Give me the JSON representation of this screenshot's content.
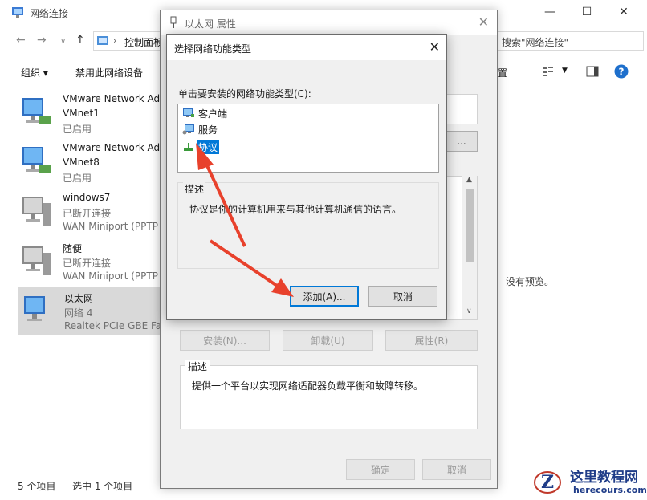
{
  "main_window": {
    "title": "网络连接",
    "breadcrumb": "控制面板",
    "search_placeholder": "搜索\"网络连接\"",
    "toolbar": {
      "organize": "组织",
      "disable_device": "禁用此网络设备",
      "partial_right": "置"
    },
    "connections": [
      {
        "name": "VMware Network Ad",
        "line2": "VMnet1",
        "line3": "已启用"
      },
      {
        "name": "VMware Network Ad",
        "line2": "VMnet8",
        "line3": "已启用"
      },
      {
        "name": "windows7",
        "line2": "已断开连接",
        "line3": "WAN Miniport (PPTP"
      },
      {
        "name": "随便",
        "line2": "已断开连接",
        "line3": "WAN Miniport (PPTP"
      },
      {
        "name": "以太网",
        "line2": "网络 4",
        "line3": "Realtek PCIe GBE Far"
      }
    ],
    "status": {
      "count": "5 个项目",
      "selected": "选中 1 个项目"
    },
    "preview_text": "没有预览。"
  },
  "properties_dialog": {
    "title": "以太网 属性",
    "buttons": {
      "install": "安装(N)...",
      "uninstall": "卸载(U)",
      "properties": "属性(R)",
      "ok": "确定",
      "cancel": "取消",
      "configure": "..."
    },
    "description_label": "描述",
    "description_text": "提供一个平台以实现网络适配器负载平衡和故障转移。"
  },
  "select_dialog": {
    "title": "选择网络功能类型",
    "prompt": "单击要安装的网络功能类型(C):",
    "options": [
      {
        "label": "客户端"
      },
      {
        "label": "服务"
      },
      {
        "label": "协议"
      }
    ],
    "description_label": "描述",
    "description_text": "协议是你的计算机用来与其他计算机通信的语言。",
    "add_button": "添加(A)...",
    "cancel_button": "取消"
  },
  "watermark": {
    "name": "这里教程网",
    "url": "herecours.com"
  },
  "colors": {
    "accent": "#0078d7",
    "arrow": "#e8412c"
  }
}
